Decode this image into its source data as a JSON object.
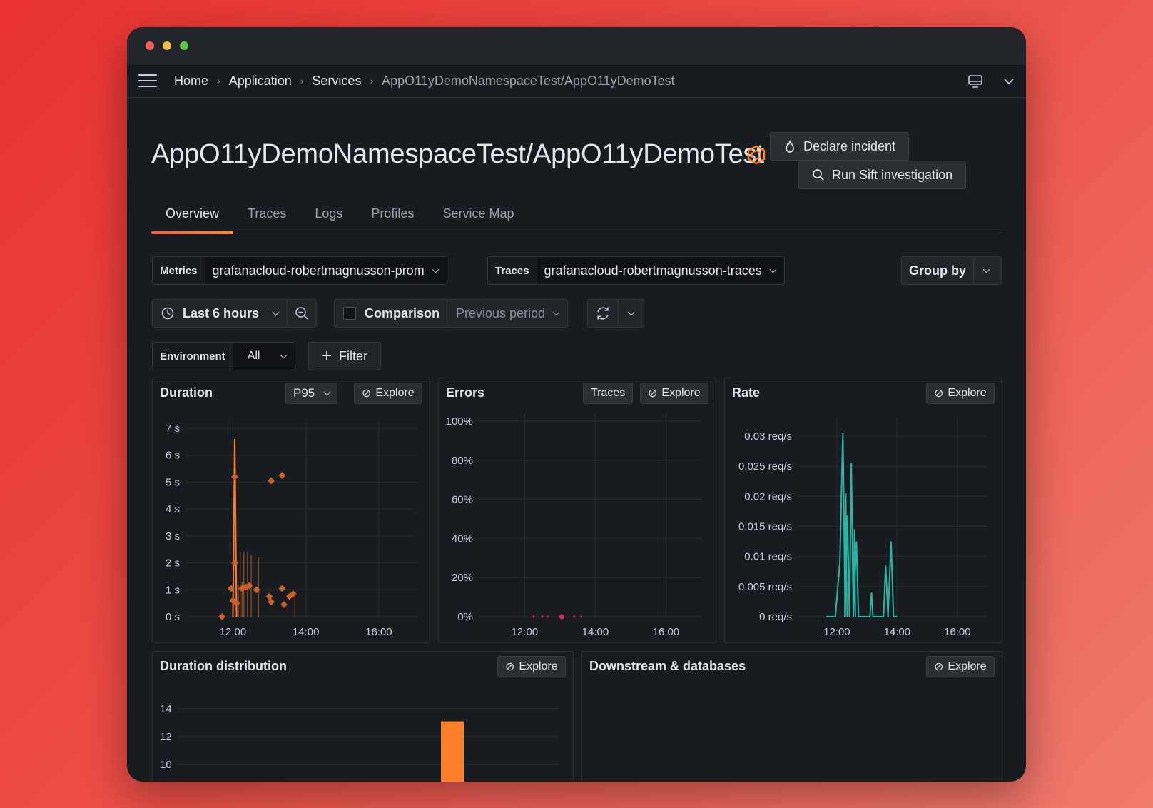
{
  "window": {
    "dots": [
      "#ee5f57",
      "#f5be3f",
      "#5fc84a"
    ]
  },
  "nav": {
    "crumbs": [
      "Home",
      "Application",
      "Services",
      "AppO11yDemoNamespaceTest/AppO11yDemoTest"
    ]
  },
  "page": {
    "title": "AppO11yDemoNamespaceTest/AppO11yDemoTest",
    "declare_incident": "Declare incident",
    "run_sift": "Run Sift investigation"
  },
  "tabs": [
    "Overview",
    "Traces",
    "Logs",
    "Profiles",
    "Service Map"
  ],
  "datasources": {
    "metrics_label": "Metrics",
    "metrics_value": "grafanacloud-robertmagnusson-prom",
    "traces_label": "Traces",
    "traces_value": "grafanacloud-robertmagnusson-traces",
    "group_by": "Group by"
  },
  "controls": {
    "time_range": "Last 6 hours",
    "comparison": "Comparison",
    "comparison_value": "Previous period"
  },
  "filters": {
    "env_label": "Environment",
    "env_value": "All",
    "add_filter": "Filter"
  },
  "panels": {
    "duration": {
      "title": "Duration",
      "percentile": "P95",
      "explore": "Explore"
    },
    "errors": {
      "title": "Errors",
      "traces": "Traces",
      "explore": "Explore"
    },
    "rate": {
      "title": "Rate",
      "explore": "Explore"
    },
    "distribution": {
      "title": "Duration distribution",
      "explore": "Explore"
    },
    "downstream": {
      "title": "Downstream & databases",
      "explore": "Explore"
    }
  },
  "colors": {
    "accent": "#ff7f2a",
    "rate": "#29b6a6",
    "error": "#e0245e"
  },
  "chart_data": [
    {
      "type": "scatter",
      "yticks": [
        "0 s",
        "1 s",
        "2 s",
        "3 s",
        "4 s",
        "5 s",
        "6 s",
        "7 s"
      ],
      "xticks": [
        "12:00",
        "14:00",
        "16:00"
      ],
      "ylim": [
        0,
        7
      ],
      "points": [
        [
          11.7,
          0
        ],
        [
          11.95,
          1.05
        ],
        [
          12.0,
          0.6
        ],
        [
          12.1,
          0.5
        ],
        [
          12.25,
          1.05
        ],
        [
          12.35,
          1.1
        ],
        [
          12.45,
          1.15
        ],
        [
          12.65,
          1.0
        ],
        [
          12.05,
          5.2
        ],
        [
          12.05,
          2.0
        ],
        [
          13.05,
          5.05
        ],
        [
          13.35,
          5.25
        ],
        [
          13.0,
          0.75
        ],
        [
          13.05,
          0.55
        ],
        [
          13.35,
          1.05
        ],
        [
          13.4,
          0.45
        ],
        [
          13.55,
          0.75
        ],
        [
          13.65,
          0.85
        ]
      ],
      "line": [
        [
          12.0,
          0
        ],
        [
          12.05,
          6.6
        ],
        [
          12.1,
          0
        ]
      ]
    },
    {
      "type": "scatter",
      "yticks": [
        "0%",
        "20%",
        "40%",
        "60%",
        "80%",
        "100%"
      ],
      "xticks": [
        "12:00",
        "14:00",
        "16:00"
      ],
      "ylim": [
        0,
        100
      ],
      "points": [
        [
          12.25,
          0
        ],
        [
          12.5,
          0
        ],
        [
          12.65,
          0
        ],
        [
          13.05,
          0
        ],
        [
          13.4,
          0
        ],
        [
          13.6,
          0
        ]
      ]
    },
    {
      "type": "line",
      "yticks": [
        "0 req/s",
        "0.005 req/s",
        "0.01 req/s",
        "0.015 req/s",
        "0.02 req/s",
        "0.025 req/s",
        "0.03 req/s"
      ],
      "xticks": [
        "12:00",
        "14:00",
        "16:00"
      ],
      "ylim": [
        0,
        0.032
      ],
      "points": [
        [
          11.65,
          0
        ],
        [
          11.95,
          0
        ],
        [
          12.1,
          0.009
        ],
        [
          12.2,
          0.0305
        ],
        [
          12.28,
          0
        ],
        [
          12.35,
          0.0168
        ],
        [
          12.42,
          0
        ],
        [
          12.48,
          0.0255
        ],
        [
          12.55,
          0
        ],
        [
          12.65,
          0.0125
        ],
        [
          12.72,
          0
        ],
        [
          13.1,
          0
        ],
        [
          13.15,
          0.004
        ],
        [
          13.2,
          0
        ],
        [
          13.55,
          0
        ],
        [
          13.62,
          0.0085
        ],
        [
          13.7,
          0
        ],
        [
          13.8,
          0.0125
        ],
        [
          13.88,
          0
        ],
        [
          14.0,
          0
        ]
      ]
    },
    {
      "type": "bar",
      "yticks": [
        "10",
        "12",
        "14"
      ],
      "ylim": [
        9,
        15
      ],
      "values": [
        13.1
      ]
    }
  ]
}
